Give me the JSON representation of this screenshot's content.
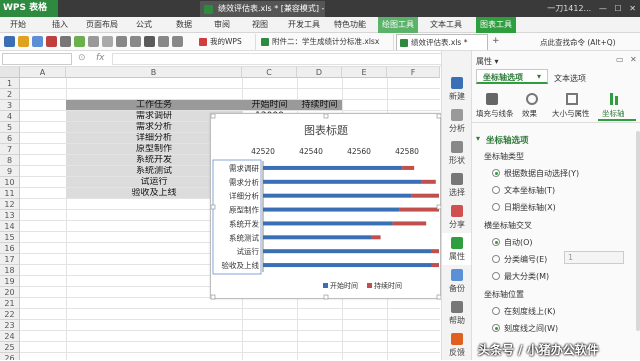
{
  "app": {
    "logo": "WPS 表格",
    "window_title": "绩效评估表.xls * [兼容模式] - WPS 表格",
    "user": "一刀1412...",
    "close": "✕"
  },
  "menu": [
    "开始",
    "插入",
    "页面布局",
    "公式",
    "数据",
    "审阅",
    "视图",
    "开发工具",
    "特色功能",
    "绘图工具",
    "文本工具",
    "图表工具"
  ],
  "doc_tabs": [
    "我的WPS",
    "附件二：学生成绩计分标准.xlsx",
    "绩效评估表.xls *"
  ],
  "toolbar_right": "点此查找命令 (Alt+Q)",
  "formula": {
    "fx": "fx",
    "value": ""
  },
  "sheet": {
    "columns": [
      "A",
      "B",
      "C",
      "D",
      "E",
      "F"
    ],
    "rows": [
      "1",
      "2",
      "3",
      "4",
      "5",
      "6",
      "7",
      "8",
      "9",
      "10",
      "11",
      "12",
      "13",
      "14",
      "15",
      "16",
      "17",
      "18",
      "19",
      "20",
      "21",
      "22",
      "23",
      "24",
      "25",
      "26",
      "27"
    ],
    "header": [
      "工作任务",
      "开始时间",
      "持续时间"
    ],
    "c4_partial": "12000",
    "tasks": [
      "需求调研",
      "需求分析",
      "详细分析",
      "原型制作",
      "系统开发",
      "系统测试",
      "试运行",
      "验收及上线"
    ]
  },
  "chart_data": {
    "type": "bar",
    "title": "图表标题",
    "orientation": "horizontal-stacked",
    "categories": [
      "需求调研",
      "需求分析",
      "详细分析",
      "原型制作",
      "系统开发",
      "系统测试",
      "试运行",
      "验收及上线"
    ],
    "x_ticks": [
      "42520",
      "42540",
      "42560",
      "42580"
    ],
    "xlim": [
      42520,
      42590
    ],
    "series": [
      {
        "name": "开始时间",
        "color": "#3a6fb5",
        "values": [
          42578,
          42586,
          42582,
          42577,
          42574,
          42565,
          42590,
          42590
        ]
      },
      {
        "name": "持续时间",
        "color": "#c0504d",
        "values": [
          5,
          6,
          18,
          20,
          14,
          4,
          4,
          6
        ]
      }
    ],
    "legend": "bottom"
  },
  "side_panel": {
    "items": [
      "新建",
      "分析",
      "形状",
      "选择",
      "分享",
      "属性",
      "备份",
      "帮助",
      "反馈"
    ]
  },
  "props": {
    "title": "属性 ▾",
    "tab_active": "坐标轴选项",
    "tab_other": "文本选项",
    "subtabs": [
      "填充与线条",
      "效果",
      "大小与属性",
      "坐标轴"
    ],
    "section": "坐标轴选项",
    "axis_type_label": "坐标轴类型",
    "axis_type_options": [
      "根据数据自动选择(Y)",
      "文本坐标轴(T)",
      "日期坐标轴(X)"
    ],
    "cross_label": "横坐标轴交叉",
    "cross_options": [
      "自动(O)",
      "分类编号(E)",
      "最大分类(M)"
    ],
    "cross_value": "1",
    "pos_label": "坐标轴位置",
    "pos_options": [
      "在刻度线上(K)",
      "刻度线之间(W)"
    ]
  },
  "watermark": "头条号 / 小猪办公软件"
}
